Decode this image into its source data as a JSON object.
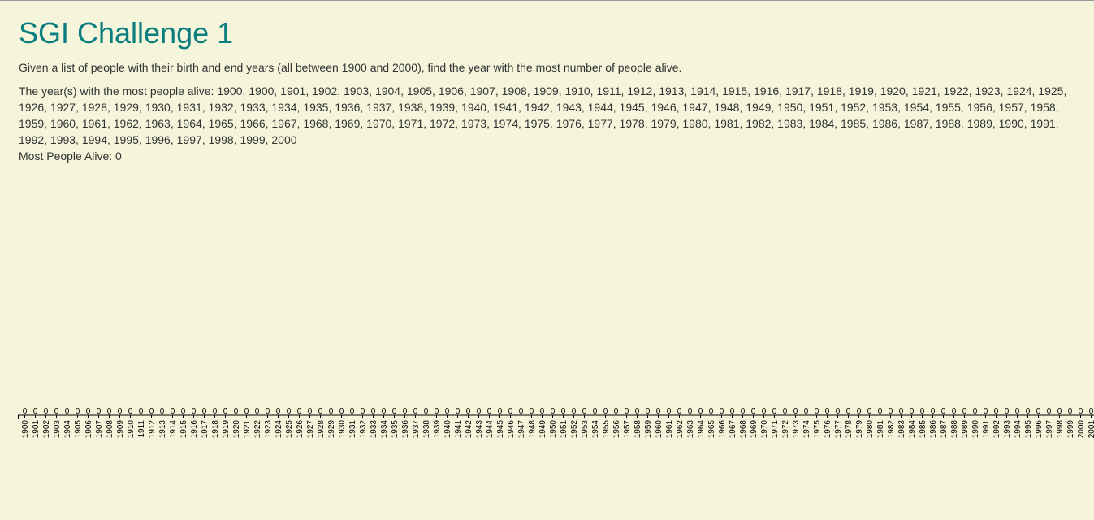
{
  "page": {
    "title": "SGI Challenge 1",
    "description": "Given a list of people with their birth and end years (all between 1900 and 2000), find the year with the most number of people alive.",
    "result_label": "The year(s) with the most people alive:",
    "result_years": [
      1900,
      1900,
      1901,
      1902,
      1903,
      1904,
      1905,
      1906,
      1907,
      1908,
      1909,
      1910,
      1911,
      1912,
      1913,
      1914,
      1915,
      1916,
      1917,
      1918,
      1919,
      1920,
      1921,
      1922,
      1923,
      1924,
      1925,
      1926,
      1927,
      1928,
      1929,
      1930,
      1931,
      1932,
      1933,
      1934,
      1935,
      1936,
      1937,
      1938,
      1939,
      1940,
      1941,
      1942,
      1943,
      1944,
      1945,
      1946,
      1947,
      1948,
      1949,
      1950,
      1951,
      1952,
      1953,
      1954,
      1955,
      1956,
      1957,
      1958,
      1959,
      1960,
      1961,
      1962,
      1963,
      1964,
      1965,
      1966,
      1967,
      1968,
      1969,
      1970,
      1971,
      1972,
      1973,
      1974,
      1975,
      1976,
      1977,
      1978,
      1979,
      1980,
      1981,
      1982,
      1983,
      1984,
      1985,
      1986,
      1987,
      1988,
      1989,
      1990,
      1991,
      1992,
      1993,
      1994,
      1995,
      1996,
      1997,
      1998,
      1999,
      2000
    ],
    "result_lines": [
      "The year(s) with the most people alive: 1900, 1900, 1901, 1902, 1903, 1904, 1905, 1906, 1907, 1908, 1909, 1910, 1911, 1912, 1913, 1914, 1915, 1916, 1917, 1918, 1919, 1920, 1921, 1922, 1923, 1924, 1925,",
      "1926, 1927, 1928, 1929, 1930, 1931, 1932, 1933, 1934, 1935, 1936, 1937, 1938, 1939, 1940, 1941, 1942, 1943, 1944, 1945, 1946, 1947, 1948, 1949, 1950, 1951, 1952, 1953, 1954, 1955, 1956, 1957, 1958,",
      "1959, 1960, 1961, 1962, 1963, 1964, 1965, 1966, 1967, 1968, 1969, 1970, 1971, 1972, 1973, 1974, 1975, 1976, 1977, 1978, 1979, 1980, 1981, 1982, 1983, 1984, 1985, 1986, 1987, 1988, 1989, 1990, 1991,",
      "1992, 1993, 1994, 1995, 1996, 1997, 1998, 1999, 2000"
    ],
    "most_alive_text": "Most People Alive: 0"
  },
  "colors": {
    "background": "#f5f5dc",
    "title": "#0a7e7e",
    "text": "#333333"
  },
  "chart_data": {
    "type": "bar",
    "categories": [
      "1900",
      "1901",
      "1902",
      "1903",
      "1904",
      "1905",
      "1906",
      "1907",
      "1908",
      "1909",
      "1910",
      "1911",
      "1912",
      "1913",
      "1914",
      "1915",
      "1916",
      "1917",
      "1918",
      "1919",
      "1920",
      "1921",
      "1922",
      "1923",
      "1924",
      "1925",
      "1926",
      "1927",
      "1928",
      "1929",
      "1930",
      "1931",
      "1932",
      "1933",
      "1934",
      "1935",
      "1936",
      "1937",
      "1938",
      "1939",
      "1940",
      "1941",
      "1942",
      "1943",
      "1944",
      "1945",
      "1946",
      "1947",
      "1948",
      "1949",
      "1950",
      "1951",
      "1952",
      "1953",
      "1954",
      "1955",
      "1956",
      "1957",
      "1958",
      "1959",
      "1960",
      "1961",
      "1962",
      "1963",
      "1964",
      "1965",
      "1966",
      "1967",
      "1968",
      "1969",
      "1970",
      "1971",
      "1972",
      "1973",
      "1974",
      "1975",
      "1976",
      "1977",
      "1978",
      "1979",
      "1980",
      "1981",
      "1982",
      "1983",
      "1984",
      "1985",
      "1986",
      "1987",
      "1988",
      "1989",
      "1990",
      "1991",
      "1992",
      "1993",
      "1994",
      "1995",
      "1996",
      "1997",
      "1998",
      "1999",
      "2000",
      "2001"
    ],
    "values": [
      0,
      0,
      0,
      0,
      0,
      0,
      0,
      0,
      0,
      0,
      0,
      0,
      0,
      0,
      0,
      0,
      0,
      0,
      0,
      0,
      0,
      0,
      0,
      0,
      0,
      0,
      0,
      0,
      0,
      0,
      0,
      0,
      0,
      0,
      0,
      0,
      0,
      0,
      0,
      0,
      0,
      0,
      0,
      0,
      0,
      0,
      0,
      0,
      0,
      0,
      0,
      0,
      0,
      0,
      0,
      0,
      0,
      0,
      0,
      0,
      0,
      0,
      0,
      0,
      0,
      0,
      0,
      0,
      0,
      0,
      0,
      0,
      0,
      0,
      0,
      0,
      0,
      0,
      0,
      0,
      0,
      0,
      0,
      0,
      0,
      0,
      0,
      0,
      0,
      0,
      0,
      0,
      0,
      0,
      0,
      0,
      0,
      0,
      0,
      0,
      0,
      0
    ],
    "title": "",
    "xlabel": "",
    "ylabel": "",
    "grid": false,
    "tick_label_rotation": "vertical"
  }
}
